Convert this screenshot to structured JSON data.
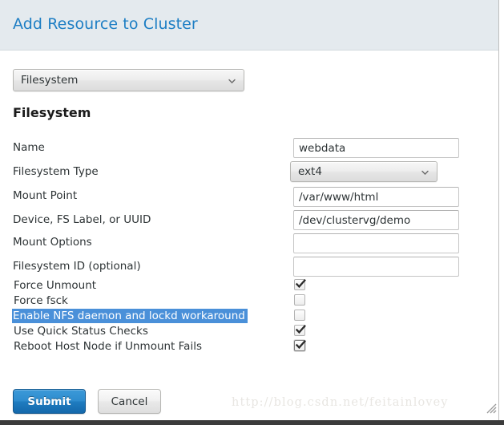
{
  "header": {
    "title": "Add Resource to Cluster"
  },
  "resource_type_select": {
    "name": "resource-type-select",
    "value": "Filesystem",
    "icon": "chevron-down-icon"
  },
  "section": {
    "heading": "Filesystem"
  },
  "text_fields": [
    {
      "label": "Name",
      "value": "webdata",
      "placeholder": ""
    },
    {
      "label": "Mount Point",
      "value": "/var/www/html",
      "placeholder": ""
    },
    {
      "label": "Device, FS Label, or UUID",
      "value": "/dev/clustervg/demo",
      "placeholder": ""
    },
    {
      "label": "Mount Options",
      "value": "",
      "placeholder": ""
    },
    {
      "label": "Filesystem ID (optional)",
      "value": "",
      "placeholder": ""
    }
  ],
  "fs_type_field": {
    "label": "Filesystem Type",
    "value": "ext4",
    "icon": "chevron-down-icon"
  },
  "checkboxes": [
    {
      "label": "Force Unmount",
      "checked": true,
      "focused": false,
      "selected": false
    },
    {
      "label": "Force fsck",
      "checked": false,
      "focused": false,
      "selected": false
    },
    {
      "label": "Enable NFS daemon and lockd workaround",
      "checked": false,
      "focused": false,
      "selected": true
    },
    {
      "label": "Use Quick Status Checks",
      "checked": true,
      "focused": false,
      "selected": false
    },
    {
      "label": "Reboot Host Node if Unmount Fails",
      "checked": true,
      "focused": true,
      "selected": false
    }
  ],
  "buttons": {
    "submit": "Submit",
    "cancel": "Cancel"
  },
  "watermark": {
    "text": "http://blog.csdn.net/feitainlovey"
  },
  "icons": {
    "resize_grip": "resize-grip-icon"
  },
  "colors": {
    "header_bg": "#e4eaee",
    "header_title": "#1d7ec4",
    "selection_blue": "#4a90d9",
    "submit_blue": "#1f7cc0",
    "watermark": "#e8e6e2"
  }
}
